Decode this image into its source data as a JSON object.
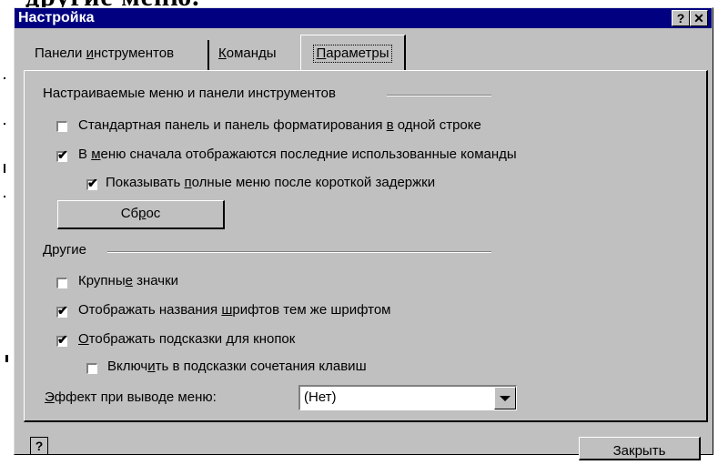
{
  "window": {
    "title": "Настройка",
    "help_glyph": "?",
    "close_glyph": "✕"
  },
  "tabs": [
    {
      "label_pre": "Панели ",
      "label_u": "и",
      "label_post": "нструментов",
      "active": false
    },
    {
      "label_pre": "",
      "label_u": "К",
      "label_post": "оманды",
      "active": false
    },
    {
      "label_pre": "",
      "label_u": "П",
      "label_post": "араметры",
      "active": true
    }
  ],
  "groups": {
    "menus": {
      "title": "Настраиваемые меню и панели инструментов",
      "items": [
        {
          "pre": "Стандартная панель и панель форматирования ",
          "u": "в",
          "post": " одной строке",
          "checked": false
        },
        {
          "pre": "В ",
          "u": "м",
          "post": "еню сначала отображаются последние использованные команды",
          "checked": true
        },
        {
          "pre": "Показывать ",
          "u": "п",
          "post": "олные меню после короткой задержки",
          "checked": true
        }
      ],
      "reset_button": {
        "pre": "Сб",
        "u": "р",
        "post": "ос"
      }
    },
    "other": {
      "title": "Другие",
      "items": [
        {
          "pre": "Крупны",
          "u": "е",
          "post": " значки",
          "checked": false
        },
        {
          "pre": "Отображать названия ",
          "u": "ш",
          "post": "рифтов тем же шрифтом",
          "checked": true
        },
        {
          "pre": "",
          "u": "О",
          "post": "тображать подсказки для кнопок",
          "checked": true
        },
        {
          "pre": "Включ",
          "u": "и",
          "post": "ть в подсказки сочетания клавиш",
          "checked": false
        }
      ]
    }
  },
  "menu_effect": {
    "label_u": "Э",
    "label_post": "ффект при выводе меню:",
    "value": "(Нет)"
  },
  "footer": {
    "help_glyph": "?",
    "close_button": "Закрыть"
  },
  "background_text": "другие меню."
}
